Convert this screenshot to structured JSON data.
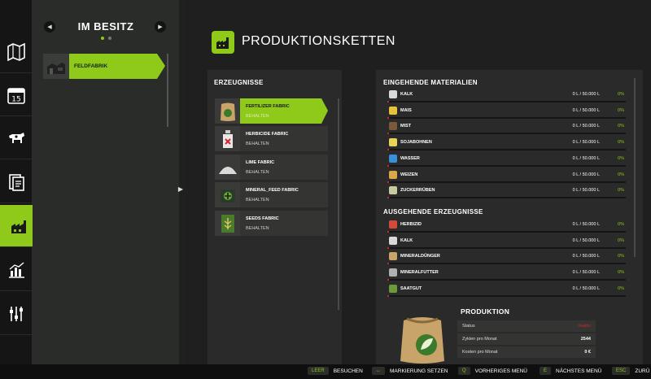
{
  "owned": {
    "title": "IM BESITZ",
    "prev_icon": "chevron-left-icon",
    "next_icon": "chevron-right-icon",
    "factory_label": "FELDFABRIK"
  },
  "rail": [
    {
      "icon": "map-icon"
    },
    {
      "icon": "calendar-icon",
      "text": "15"
    },
    {
      "icon": "cow-icon"
    },
    {
      "icon": "contracts-icon"
    },
    {
      "icon": "production-icon"
    },
    {
      "icon": "statistics-icon"
    },
    {
      "icon": "settings-icon"
    }
  ],
  "header": {
    "title": "PRODUKTIONSKETTEN"
  },
  "products": {
    "title": "ERZEUGNISSE",
    "items": [
      {
        "name": "FERTILIZER FABRIC",
        "state": "BEHALTEN",
        "icon": "fertilizer-sack-icon"
      },
      {
        "name": "HERBICIDE FABRIC",
        "state": "BEHALTEN",
        "icon": "herbicide-bottle-icon"
      },
      {
        "name": "LIME FABRIC",
        "state": "BEHALTEN",
        "icon": "lime-pile-icon"
      },
      {
        "name": "MINERAL_FEED FABRIC",
        "state": "BEHALTEN",
        "icon": "mineral-feed-icon"
      },
      {
        "name": "SEEDS FABRIC",
        "state": "BEHALTEN",
        "icon": "seeds-bag-icon"
      }
    ]
  },
  "incoming": {
    "title": "EINGEHENDE MATERIALIEN",
    "rows": [
      {
        "name": "KALK",
        "amount": "0 L / 50.000 L",
        "pct": "0%",
        "color": "#d9d9d9"
      },
      {
        "name": "MAIS",
        "amount": "0 L / 50.000 L",
        "pct": "0%",
        "color": "#e6c13a"
      },
      {
        "name": "MIST",
        "amount": "0 L / 50.000 L",
        "pct": "0%",
        "color": "#7a5a3a"
      },
      {
        "name": "SOJABOHNEN",
        "amount": "0 L / 50.000 L",
        "pct": "0%",
        "color": "#e8d45a"
      },
      {
        "name": "WASSER",
        "amount": "0 L / 50.000 L",
        "pct": "0%",
        "color": "#3a8fd9"
      },
      {
        "name": "WEIZEN",
        "amount": "0 L / 50.000 L",
        "pct": "0%",
        "color": "#d9a84a"
      },
      {
        "name": "ZUCKERRÜBEN",
        "amount": "0 L / 50.000 L",
        "pct": "0%",
        "color": "#c9c9a0"
      }
    ]
  },
  "outgoing": {
    "title": "AUSGEHENDE ERZEUGNISSE",
    "rows": [
      {
        "name": "HERBIZID",
        "amount": "0 L / 50.000 L",
        "pct": "0%",
        "color": "#d44a3a"
      },
      {
        "name": "KALK",
        "amount": "0 L / 50.000 L",
        "pct": "0%",
        "color": "#d9d9d9"
      },
      {
        "name": "MINERALDÜNGER",
        "amount": "0 L / 50.000 L",
        "pct": "0%",
        "color": "#c9a46a"
      },
      {
        "name": "MINERALFUTTER",
        "amount": "0 L / 50.000 L",
        "pct": "0%",
        "color": "#b0b0b0"
      },
      {
        "name": "SAATGUT",
        "amount": "0 L / 50.000 L",
        "pct": "0%",
        "color": "#6a9a3a"
      }
    ]
  },
  "production": {
    "title": "PRODUKTION",
    "status_label": "Status",
    "status_value": "Inaktiv",
    "cycles_label": "Zyklen pro Monat",
    "cycles_value": "2544",
    "cost_label": "Kosten pro Monat",
    "cost_value": "0 €"
  },
  "footer": [
    {
      "key": "LEER",
      "label": "BESUCHEN"
    },
    {
      "key": "↔",
      "label": "MARKIERUNG SETZEN"
    },
    {
      "key": "Q",
      "label": "VORHERIGES MENÜ"
    },
    {
      "key": "E",
      "label": "NÄCHSTES MENÜ"
    },
    {
      "key": "ESC",
      "label": "ZURÜ"
    }
  ],
  "colors": {
    "accent": "#8fc919",
    "alert": "#d4232b"
  }
}
